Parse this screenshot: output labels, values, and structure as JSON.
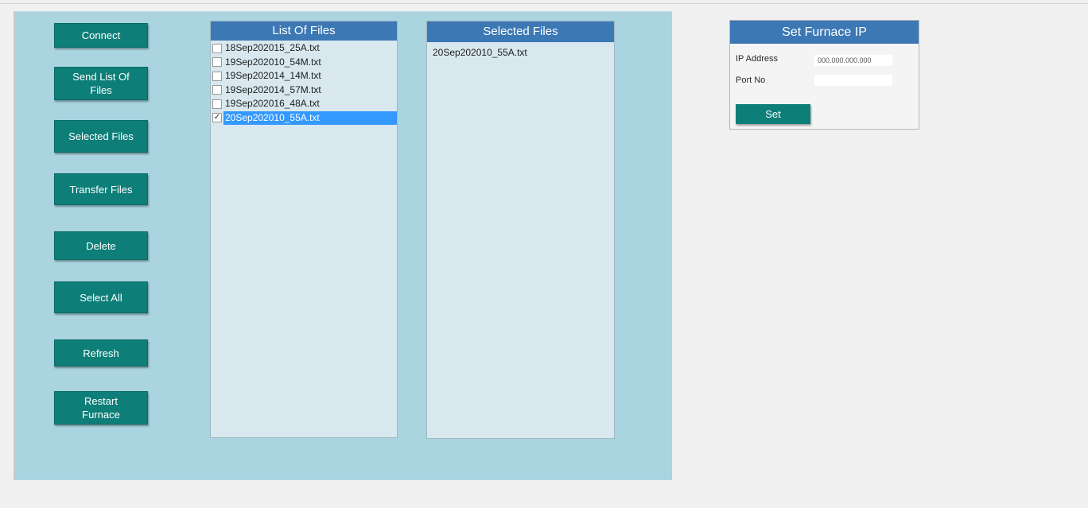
{
  "buttons": {
    "connect": "Connect",
    "send_list": "Send List Of\nFiles",
    "selected_files": "Selected Files",
    "transfer_files": "Transfer Files",
    "delete": "Delete",
    "select_all": "Select All",
    "refresh": "Refresh",
    "restart_furnace": "Restart\nFurnace"
  },
  "file_list": {
    "title": "List Of Files",
    "items": [
      {
        "name": "18Sep202015_25A.txt",
        "checked": false,
        "selected": false
      },
      {
        "name": "19Sep202010_54M.txt",
        "checked": false,
        "selected": false
      },
      {
        "name": "19Sep202014_14M.txt",
        "checked": false,
        "selected": false
      },
      {
        "name": "19Sep202014_57M.txt",
        "checked": false,
        "selected": false
      },
      {
        "name": "19Sep202016_48A.txt",
        "checked": false,
        "selected": false
      },
      {
        "name": "20Sep202010_55A.txt",
        "checked": true,
        "selected": true
      }
    ]
  },
  "selected_list": {
    "title": "Selected Files",
    "items": [
      "20Sep202010_55A.txt"
    ]
  },
  "furnace_ip": {
    "title": "Set Furnace IP",
    "ip_label": "IP Address",
    "ip_value": "000.000.000.000",
    "port_label": "Port No",
    "port_value": "",
    "set_label": "Set"
  },
  "colors": {
    "button_teal": "#0e7f78",
    "header_blue": "#3c78b4",
    "panel_bg": "#a9d4e0",
    "list_bg": "#d8e8ee",
    "selection_blue": "#3399ff"
  }
}
